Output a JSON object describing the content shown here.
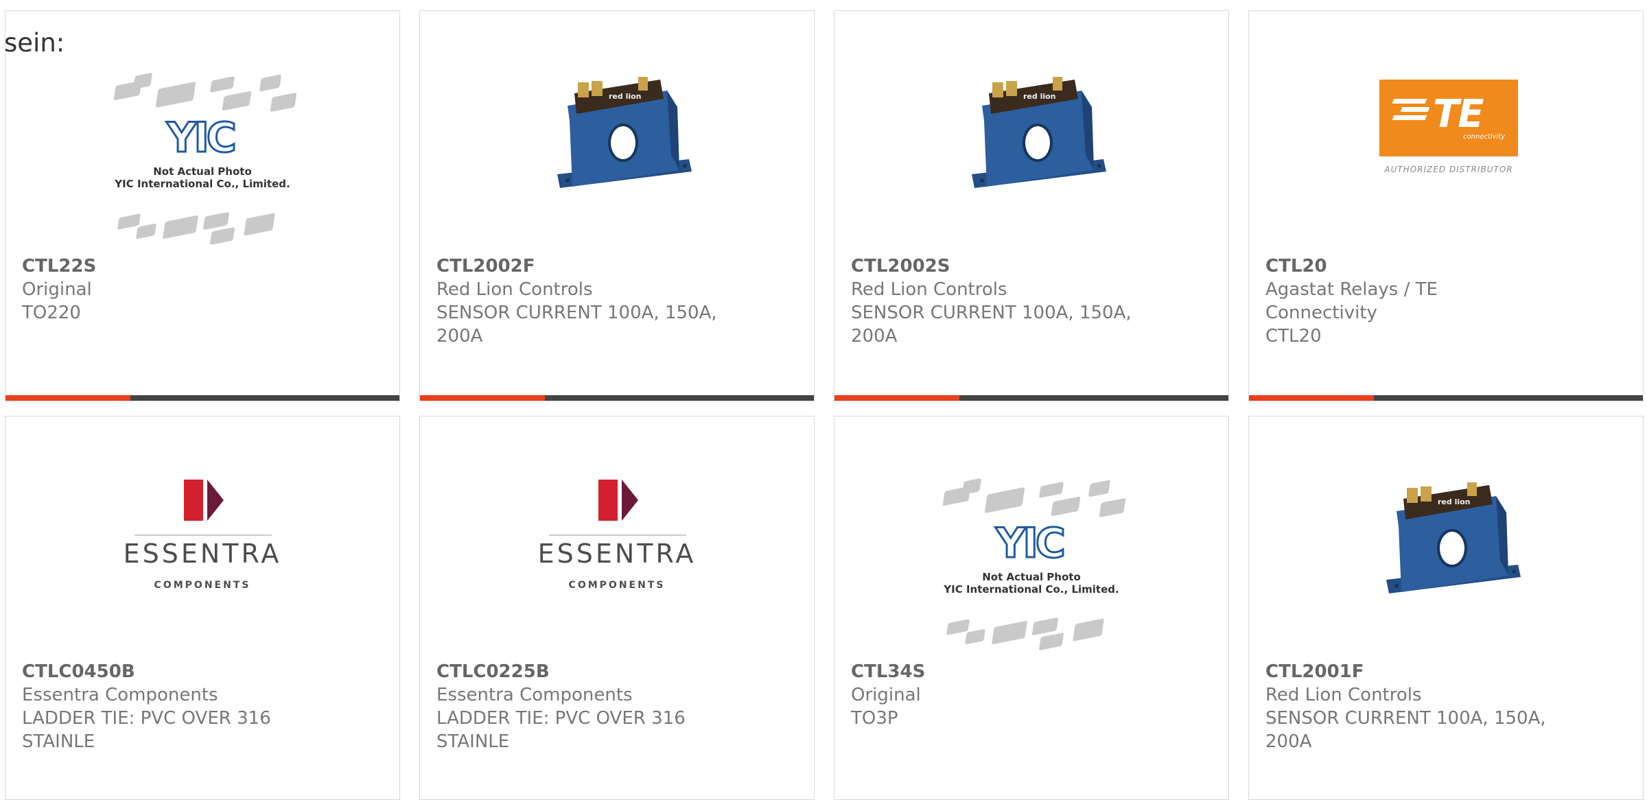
{
  "page": {
    "intro_text": "sein:"
  },
  "colors": {
    "accent": "#e8401c",
    "bar": "#444444",
    "border": "#d9d9d9",
    "te_orange": "#f08a1c",
    "essentra_red": "#d4202e",
    "sensor_blue": "#2d5e9e"
  },
  "products": [
    {
      "part_number": "CTL22S",
      "manufacturer": "Original",
      "description": "TO220",
      "image": "yic-placeholder"
    },
    {
      "part_number": "CTL2002F",
      "manufacturer": "Red Lion Controls",
      "description": "SENSOR CURRENT 100A, 150A, 200A",
      "image": "current-sensor"
    },
    {
      "part_number": "CTL2002S",
      "manufacturer": "Red Lion Controls",
      "description": "SENSOR CURRENT 100A, 150A, 200A",
      "image": "current-sensor"
    },
    {
      "part_number": "CTL20",
      "manufacturer": "Agastat Relays / TE Connectivity",
      "description": "CTL20",
      "image": "te-connectivity-logo"
    },
    {
      "part_number": "CTLC0450B",
      "manufacturer": "Essentra Components",
      "description": "LADDER TIE: PVC OVER 316 STAINLE",
      "image": "essentra-logo"
    },
    {
      "part_number": "CTLC0225B",
      "manufacturer": "Essentra Components",
      "description": "LADDER TIE: PVC OVER 316 STAINLE",
      "image": "essentra-logo"
    },
    {
      "part_number": "CTL34S",
      "manufacturer": "Original",
      "description": "TO3P",
      "image": "yic-placeholder"
    },
    {
      "part_number": "CTL2001F",
      "manufacturer": "Red Lion Controls",
      "description": "SENSOR CURRENT 100A, 150A, 200A",
      "image": "current-sensor"
    }
  ],
  "image_text": {
    "yic_line1": "Not Actual Photo",
    "yic_line2": "YIC International Co., Limited.",
    "yic_logo": "YIC",
    "te_word": "TE",
    "te_sub": "connectivity",
    "te_dist": "AUTHORIZED DISTRIBUTOR",
    "essentra_word": "ESSENTRA",
    "essentra_sub": "COMPONENTS",
    "sensor_label": "red lion"
  }
}
